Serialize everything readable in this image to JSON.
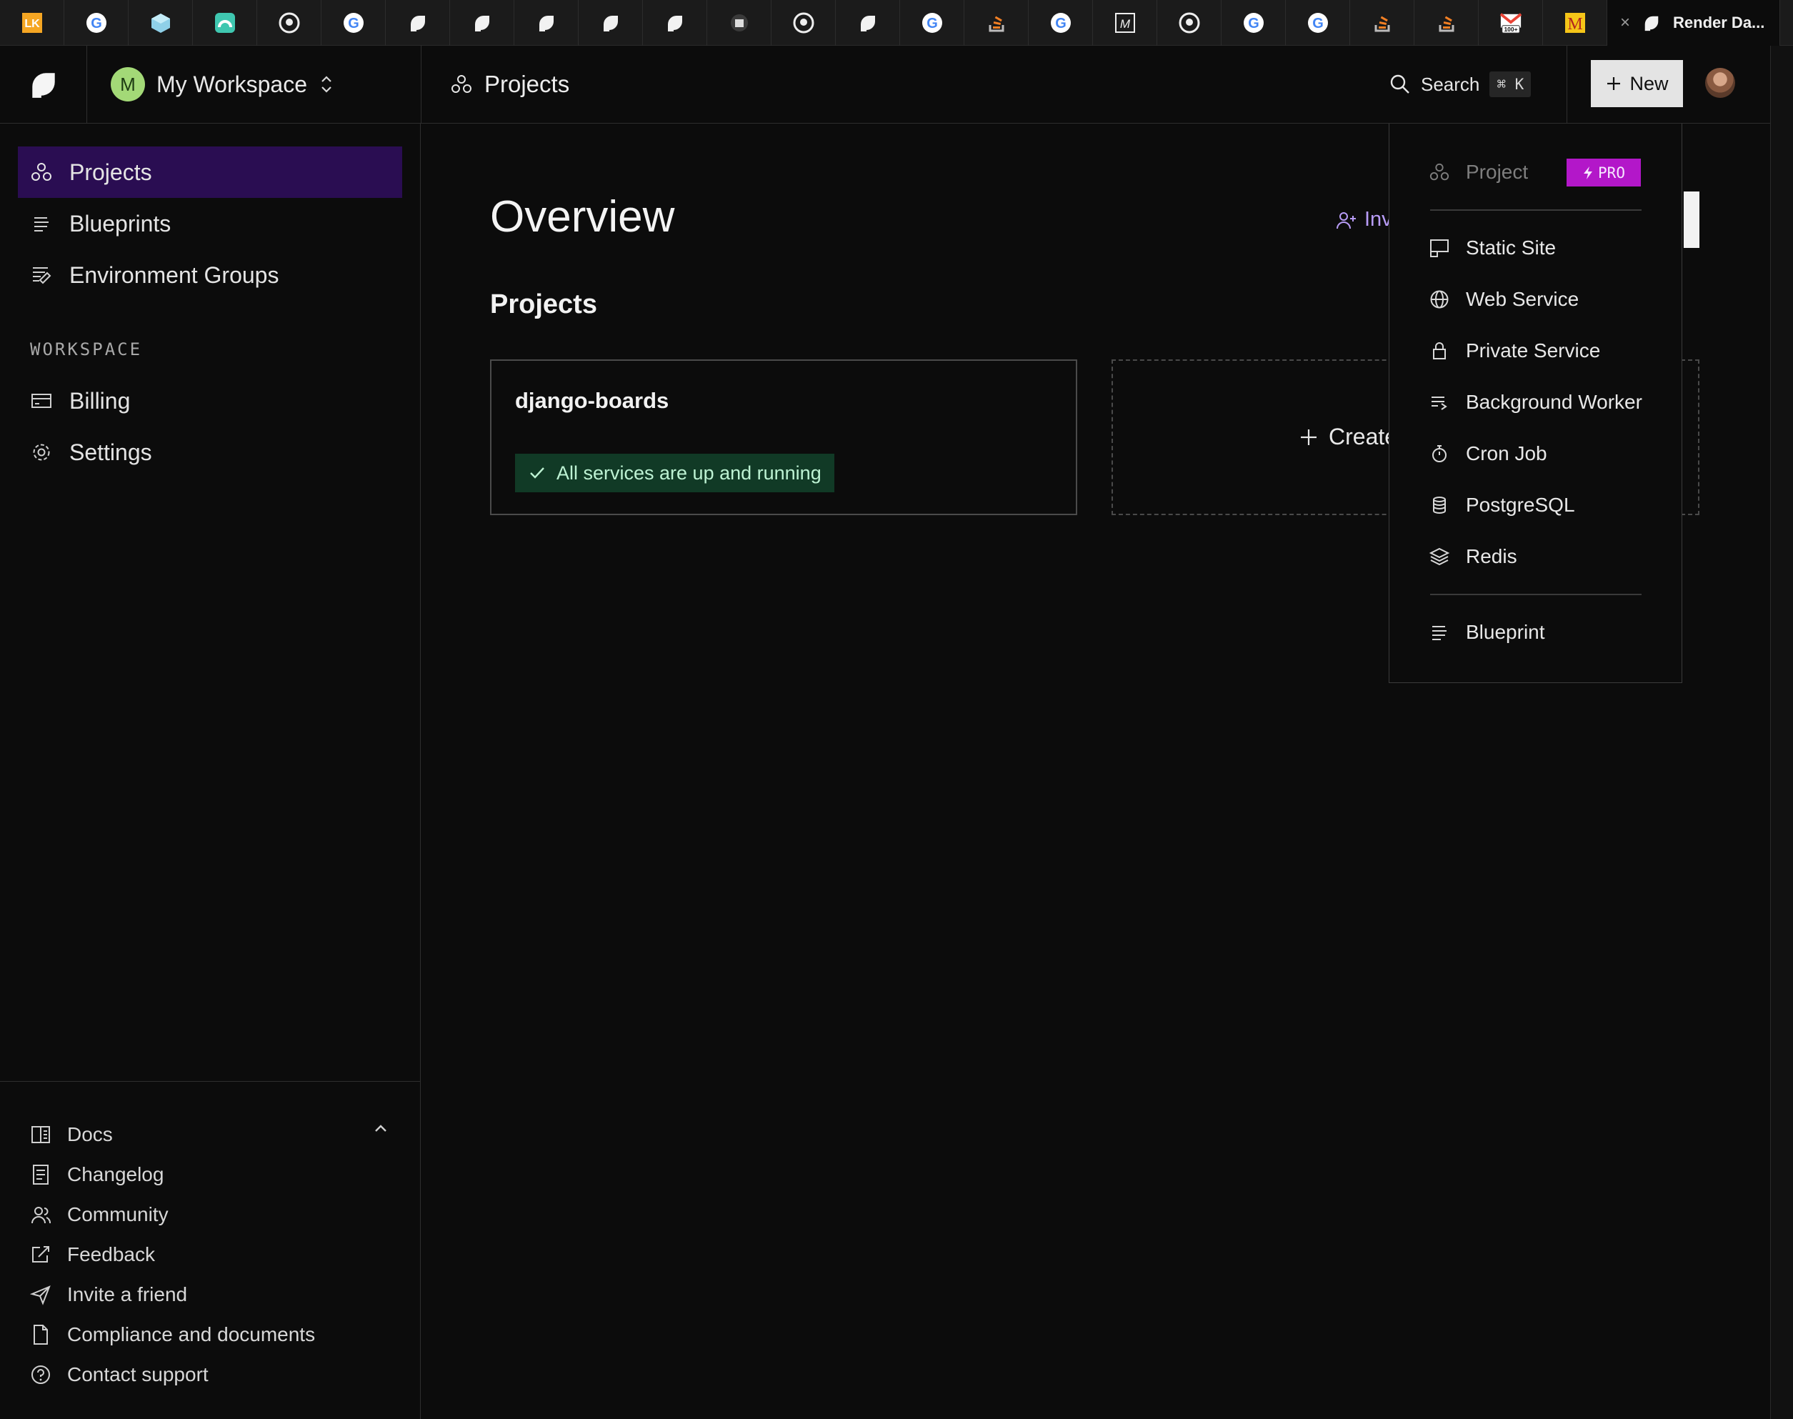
{
  "browser": {
    "tabs": [
      {
        "icon": "lk-icon",
        "color": "#f5a623"
      },
      {
        "icon": "google-icon"
      },
      {
        "icon": "cube-icon",
        "color": "#8fd0e8"
      },
      {
        "icon": "rainbow-icon",
        "color": "#3fc7b0"
      },
      {
        "icon": "github-icon"
      },
      {
        "icon": "google-icon"
      },
      {
        "icon": "render-icon"
      },
      {
        "icon": "render-icon"
      },
      {
        "icon": "render-icon"
      },
      {
        "icon": "render-icon"
      },
      {
        "icon": "render-icon"
      },
      {
        "icon": "box-icon"
      },
      {
        "icon": "github-icon"
      },
      {
        "icon": "render-icon"
      },
      {
        "icon": "google-icon"
      },
      {
        "icon": "stackoverflow-icon",
        "color": "#f48024"
      },
      {
        "icon": "google-icon"
      },
      {
        "icon": "m-box-icon"
      },
      {
        "icon": "github-icon"
      },
      {
        "icon": "google-icon"
      },
      {
        "icon": "google-icon"
      },
      {
        "icon": "stackoverflow-icon",
        "color": "#f48024"
      },
      {
        "icon": "stackoverflow-icon",
        "color": "#f48024"
      },
      {
        "icon": "gmail-icon",
        "badge": "100+"
      },
      {
        "icon": "m-icon",
        "color": "#f5c518"
      }
    ],
    "active_tab": {
      "title": "Render Da...",
      "icon": "render-icon"
    }
  },
  "header": {
    "workspace": {
      "initial": "M",
      "name": "My Workspace",
      "avatar_color": "#a3d977"
    },
    "title": "Projects",
    "search": {
      "label": "Search",
      "shortcut": "⌘ K"
    },
    "new_button": "New"
  },
  "sidebar": {
    "nav": [
      {
        "label": "Projects",
        "icon": "projects-icon",
        "active": true
      },
      {
        "label": "Blueprints",
        "icon": "blueprint-icon"
      },
      {
        "label": "Environment Groups",
        "icon": "env-groups-icon"
      }
    ],
    "section_label": "WORKSPACE",
    "workspace_nav": [
      {
        "label": "Billing",
        "icon": "billing-icon"
      },
      {
        "label": "Settings",
        "icon": "gear-icon"
      }
    ],
    "footer": [
      {
        "label": "Docs",
        "icon": "docs-icon"
      },
      {
        "label": "Changelog",
        "icon": "changelog-icon"
      },
      {
        "label": "Community",
        "icon": "community-icon"
      },
      {
        "label": "Feedback",
        "icon": "feedback-icon"
      },
      {
        "label": "Invite a friend",
        "icon": "send-icon"
      },
      {
        "label": "Compliance and documents",
        "icon": "document-icon"
      },
      {
        "label": "Contact support",
        "icon": "help-icon"
      }
    ]
  },
  "main": {
    "title": "Overview",
    "invite_label": "Inv",
    "projects_heading": "Projects",
    "project_card": {
      "name": "django-boards",
      "status": "All services are up and running"
    },
    "create_label": "Create"
  },
  "new_menu": {
    "project": {
      "label": "Project",
      "badge": "PRO"
    },
    "services": [
      {
        "label": "Static Site",
        "icon": "static-site-icon"
      },
      {
        "label": "Web Service",
        "icon": "globe-icon"
      },
      {
        "label": "Private Service",
        "icon": "lock-icon"
      },
      {
        "label": "Background Worker",
        "icon": "worker-icon"
      },
      {
        "label": "Cron Job",
        "icon": "stopwatch-icon"
      },
      {
        "label": "PostgreSQL",
        "icon": "database-icon"
      },
      {
        "label": "Redis",
        "icon": "layers-icon"
      }
    ],
    "blueprint": {
      "label": "Blueprint",
      "icon": "blueprint-icon"
    }
  },
  "colors": {
    "accent_active": "#2a0d52",
    "status_bg": "#113a26",
    "pro_badge": "#b317c9",
    "invite_link": "#b89cf7"
  }
}
